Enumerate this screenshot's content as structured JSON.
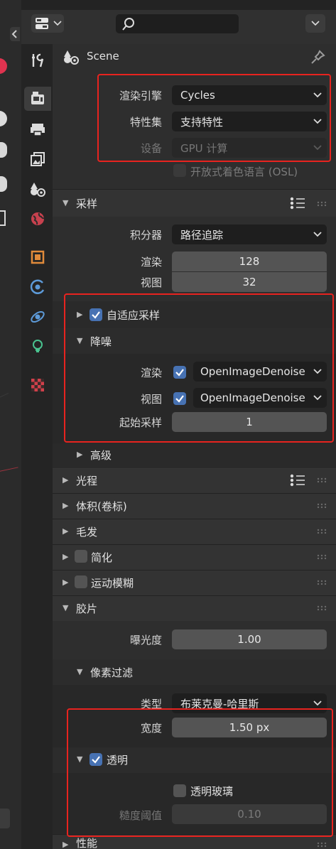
{
  "header": {
    "search_placeholder": ""
  },
  "scene": {
    "title": "Scene"
  },
  "render": {
    "engine_label": "渲染引擎",
    "engine_value": "Cycles",
    "featureset_label": "特性集",
    "featureset_value": "支持特性",
    "device_label": "设备",
    "device_value": "GPU 计算",
    "osl_label": "开放式着色语言 (OSL)"
  },
  "sampling": {
    "title": "采样",
    "integrator_label": "积分器",
    "integrator_value": "路径追踪",
    "render_label": "渲染",
    "render_value": "128",
    "viewport_label": "视图",
    "viewport_value": "32",
    "adaptive_label": "自适应采样",
    "denoise": {
      "title": "降噪",
      "render_label": "渲染",
      "render_value": "OpenImageDenoise",
      "viewport_label": "视图",
      "viewport_value": "OpenImageDenoise",
      "start_label": "起始采样",
      "start_value": "1"
    },
    "advanced": "高级"
  },
  "panels": {
    "light_paths": "光程",
    "volumes": "体积(卷标)",
    "hair": "毛发",
    "simplify": "简化",
    "motion_blur": "运动模糊",
    "film": "胶片",
    "performance": "性能"
  },
  "film": {
    "exposure_label": "曝光度",
    "exposure_value": "1.00",
    "pixel_filter_title": "像素过滤",
    "type_label": "类型",
    "type_value": "布莱克曼-哈里斯",
    "width_label": "宽度",
    "width_value": "1.50 px",
    "transparent_label": "透明",
    "transparent_glass_label": "透明玻璃",
    "roughness_label": "糙度阈值",
    "roughness_value": "0.10"
  },
  "colors": {
    "highlight": "#e8231f",
    "checkbox_on": "#4772b3",
    "field": "#545454",
    "dropdown": "#1e1e1e"
  }
}
